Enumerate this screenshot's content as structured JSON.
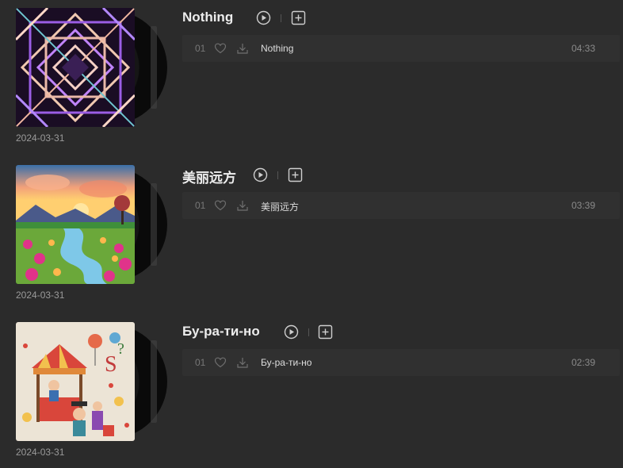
{
  "albums": [
    {
      "title": "Nothing",
      "date": "2024-03-31",
      "cover_icon": "album-cover-geometric-neon",
      "tracks": [
        {
          "number": "01",
          "name": "Nothing",
          "duration": "04:33"
        }
      ]
    },
    {
      "title": "美丽远方",
      "date": "2024-03-31",
      "cover_icon": "album-cover-sunset-landscape",
      "tracks": [
        {
          "number": "01",
          "name": "美丽远方",
          "duration": "03:39"
        }
      ]
    },
    {
      "title": "Бу-ра-ти-но",
      "date": "2024-03-31",
      "cover_icon": "album-cover-carnival-puppets",
      "tracks": [
        {
          "number": "01",
          "name": "Бу-ра-ти-но",
          "duration": "02:39"
        }
      ]
    }
  ],
  "icons": {
    "play": "play-circle-icon",
    "add": "add-square-icon",
    "like": "heart-icon",
    "download": "download-icon"
  },
  "colors": {
    "background": "#2b2b2b",
    "track_row": "#303030",
    "text_primary": "#ececec",
    "text_muted": "#9a9a9a"
  }
}
